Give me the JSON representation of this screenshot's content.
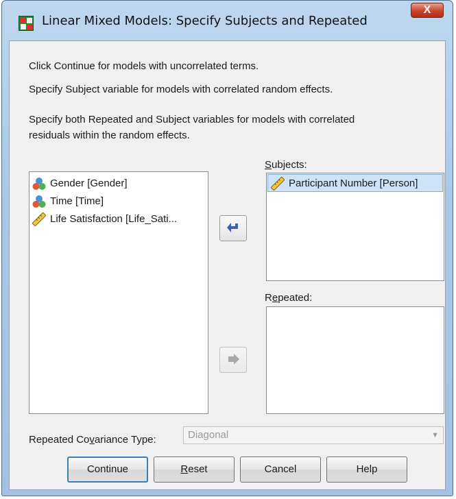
{
  "window": {
    "title": "Linear Mixed Models: Specify Subjects and Repeated",
    "close_glyph": "X"
  },
  "instructions": [
    "Click Continue for models with uncorrelated terms.",
    "Specify Subject variable for models with correlated random effects.",
    "Specify both Repeated and Subject variables for models with correlated",
    "residuals within the random effects."
  ],
  "variables": [
    {
      "label": "Gender [Gender]",
      "icon": "nominal-variable-icon"
    },
    {
      "label": "Time [Time]",
      "icon": "nominal-variable-icon"
    },
    {
      "label": "Life Satisfaction [Life_Sati...",
      "icon": "scale-variable-icon"
    }
  ],
  "subjects": {
    "label_prefix": "",
    "label_mnemonic": "S",
    "label_rest": "ubjects:",
    "items": [
      {
        "label": "Participant Number [Person]",
        "icon": "scale-variable-icon"
      }
    ]
  },
  "repeated": {
    "label_prefix": "R",
    "label_mnemonic": "e",
    "label_rest": "peated:"
  },
  "covariance": {
    "label_prefix": "Repeated Co",
    "label_mnemonic": "v",
    "label_rest": "ariance Type:",
    "value": "Diagonal"
  },
  "buttons": {
    "continue": "Continue",
    "reset_mnemonic": "R",
    "reset_rest": "eset",
    "cancel": "Cancel",
    "help": "Help"
  },
  "icons": {
    "move_subject": "left-arrow-icon",
    "move_repeated": "right-arrow-icon"
  }
}
